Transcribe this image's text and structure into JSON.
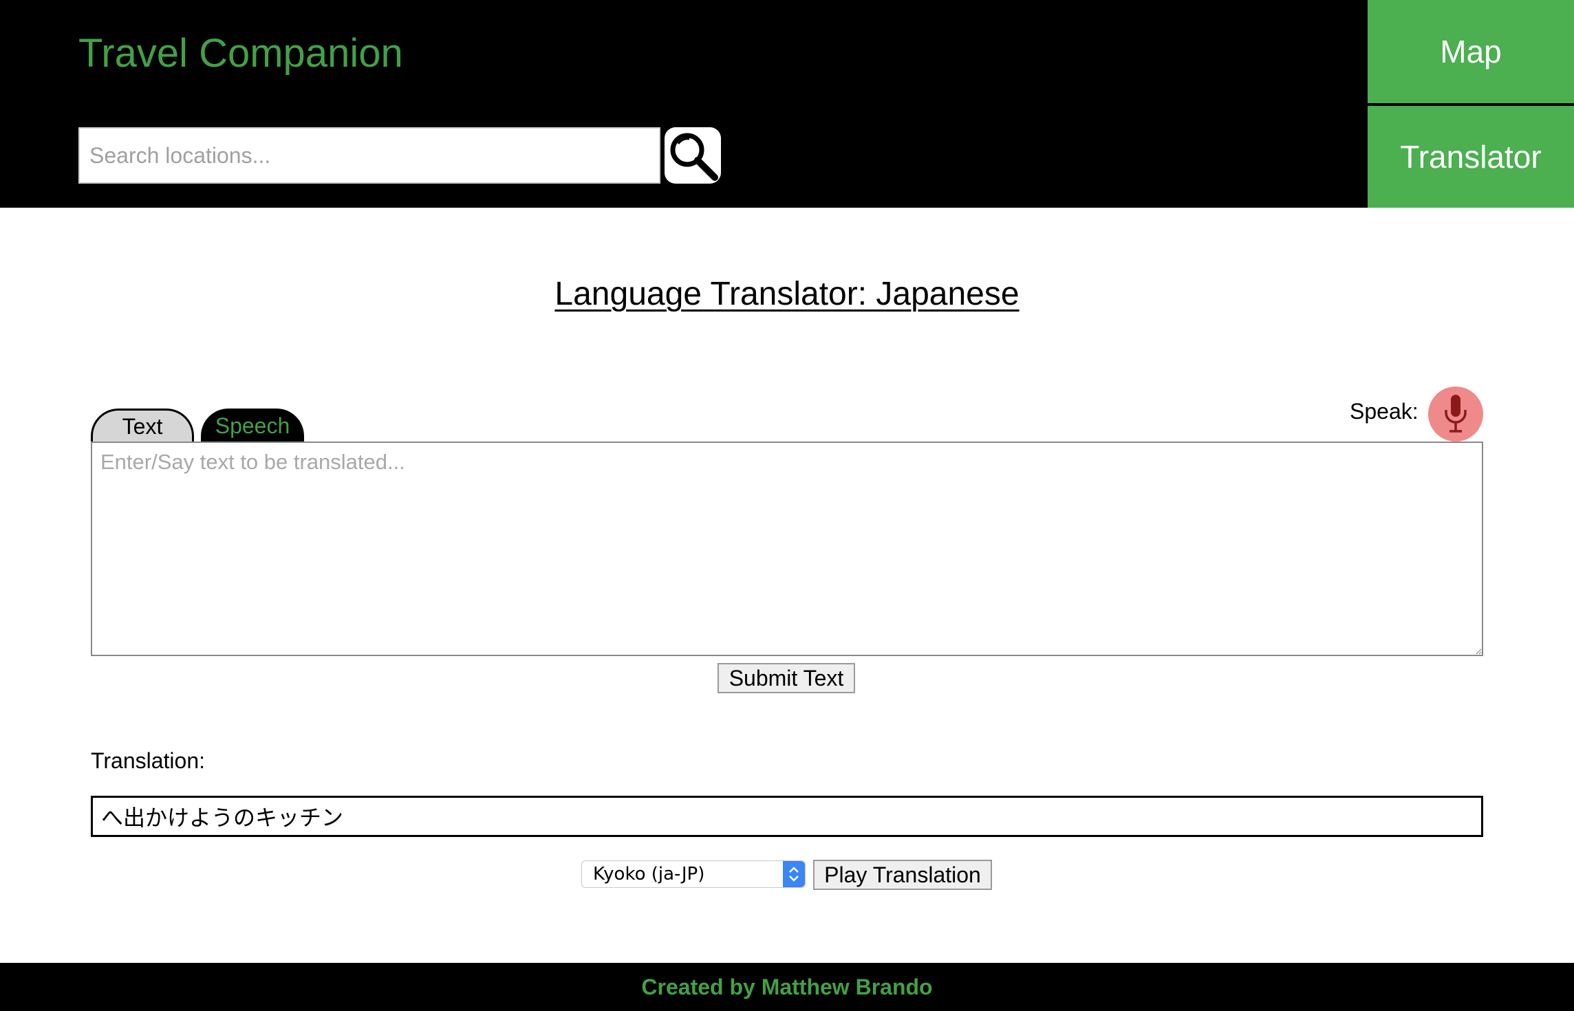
{
  "header": {
    "brand": "Travel Companion",
    "search": {
      "placeholder": "Search locations...",
      "value": "",
      "icon": "magnifying-glass"
    },
    "nav": {
      "items": [
        {
          "label": "Map"
        },
        {
          "label": "Translator"
        }
      ]
    }
  },
  "main": {
    "title": "Language Translator: Japanese",
    "tabs": [
      {
        "label": "Text",
        "active": false
      },
      {
        "label": "Speech",
        "active": true
      }
    ],
    "speak_label": "Speak:",
    "mic_icon": "microphone",
    "source": {
      "placeholder": "Enter/Say text to be translated...",
      "value": ""
    },
    "submit_label": "Submit Text",
    "translation_label": "Translation:",
    "translation_value": "へ出かけようのキッチン",
    "voice_select": {
      "selected": "Kyoko (ja-JP)"
    },
    "play_label": "Play Translation"
  },
  "footer": {
    "text": "Created by Matthew Brando"
  },
  "colors": {
    "brand_green": "#43a047",
    "nav_green": "#4caf50",
    "header_bg": "#000000",
    "mic_bg": "#f08a8a",
    "mic_icon": "#8b1a1a",
    "select_arrow_bg": "#3b86f5"
  }
}
